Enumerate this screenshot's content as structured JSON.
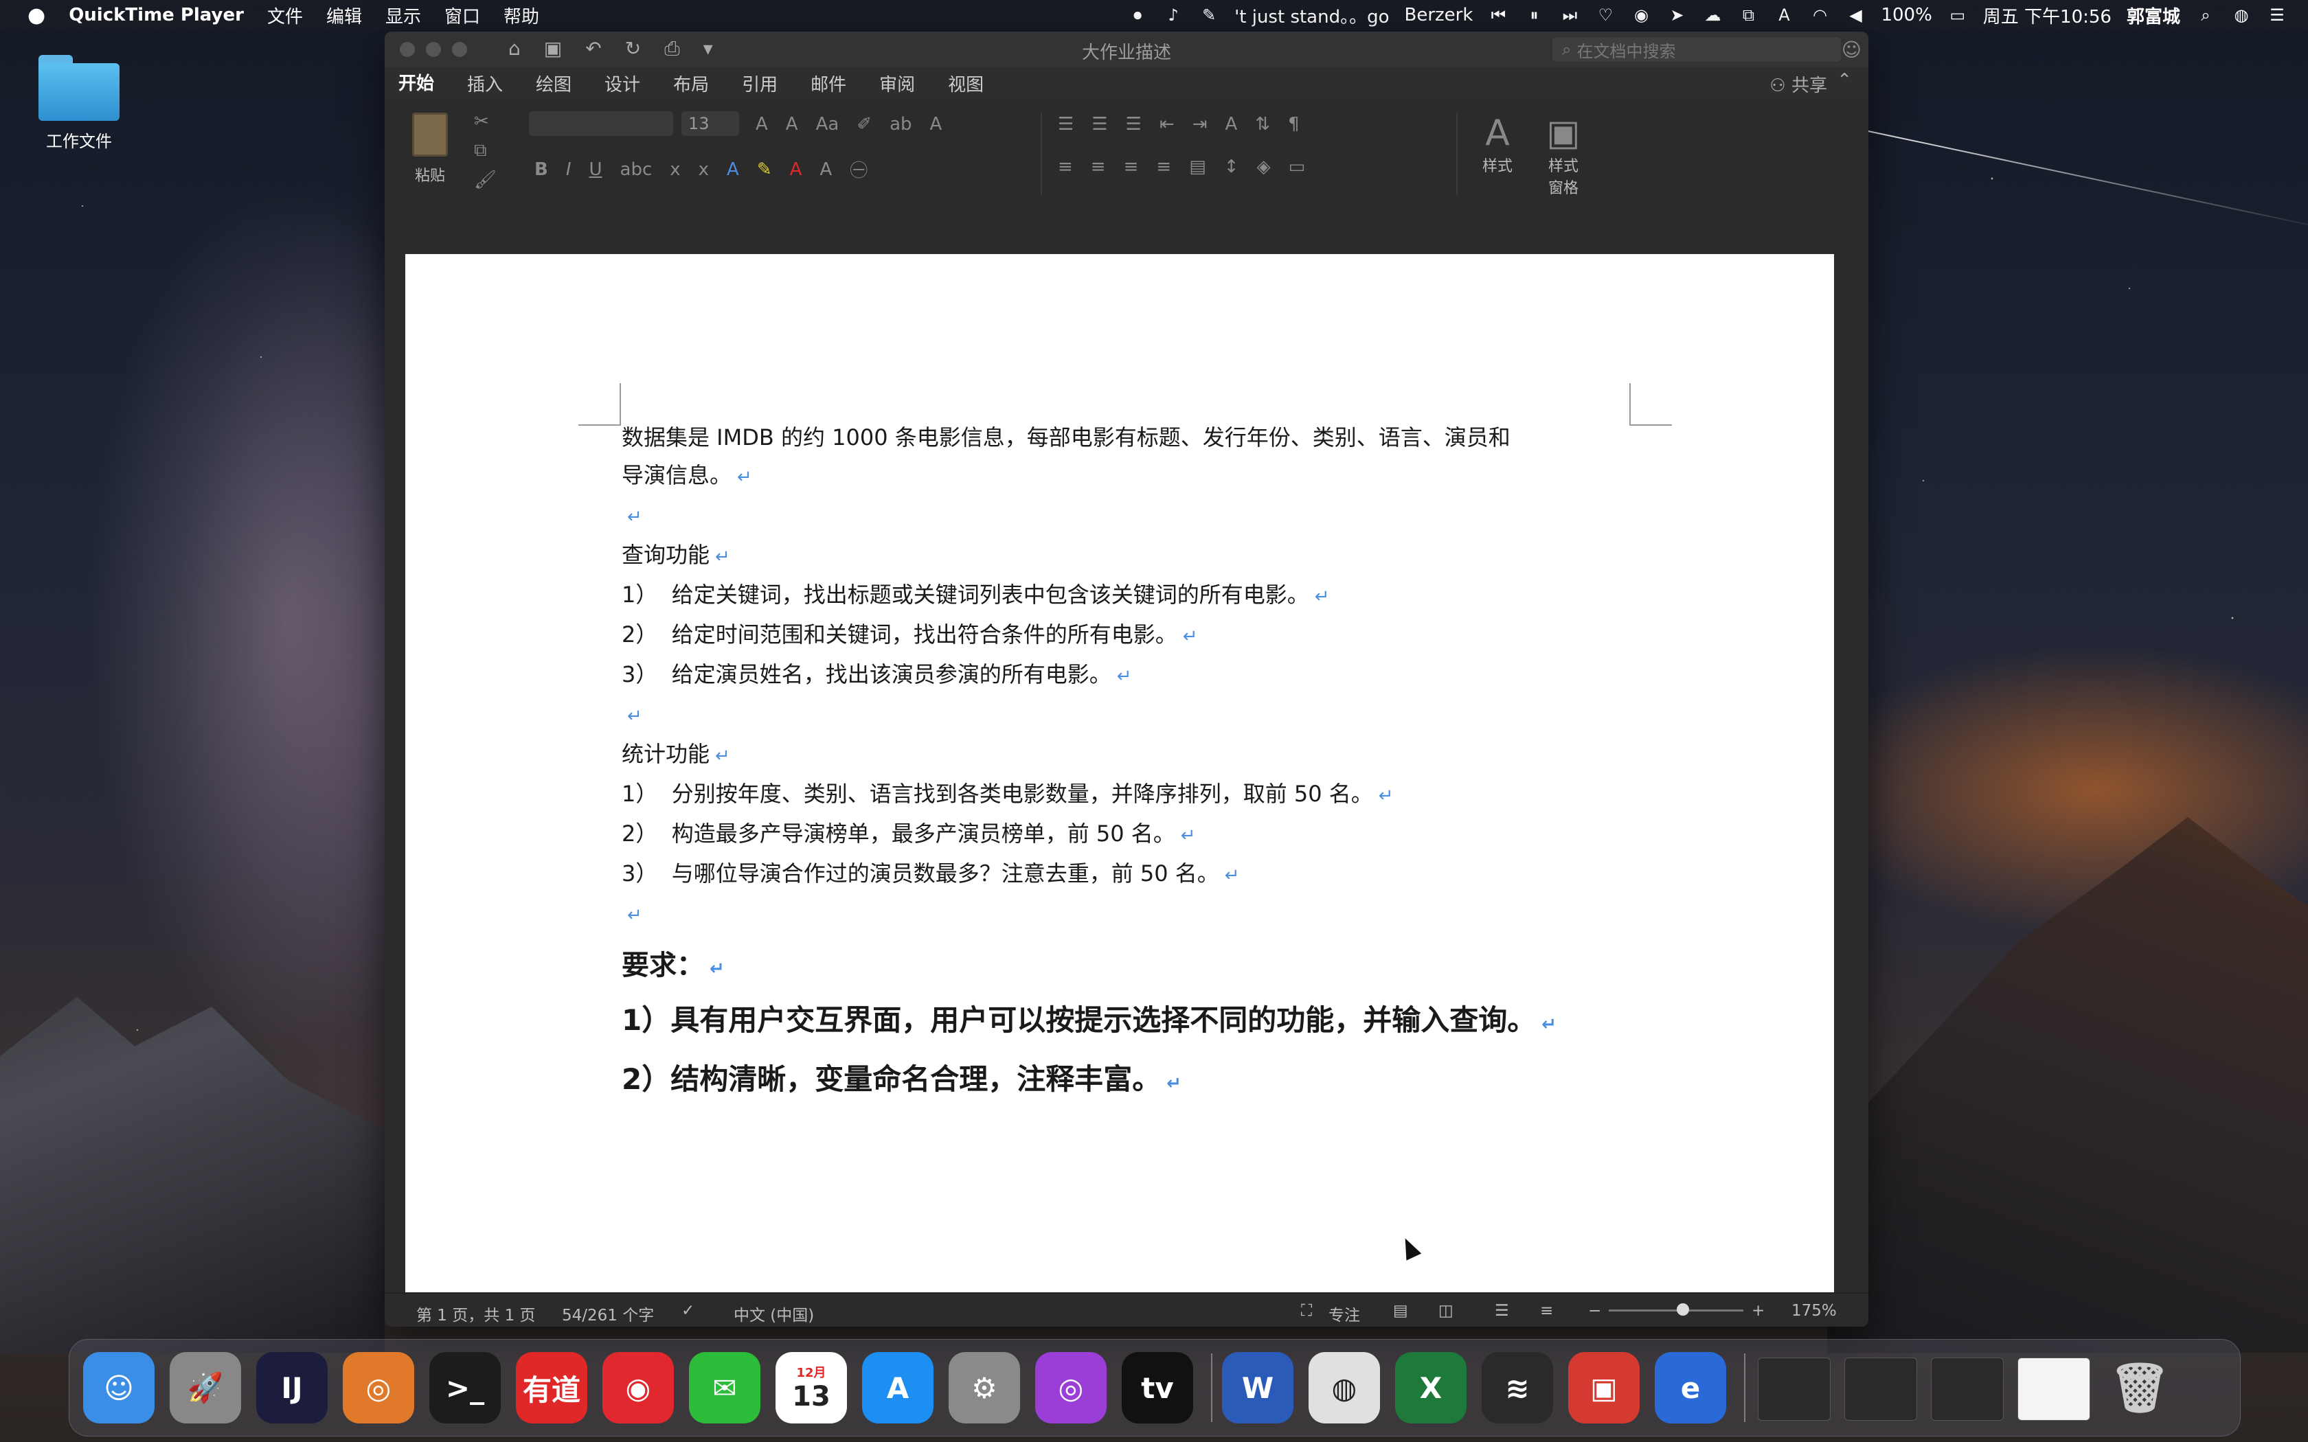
{
  "menubar": {
    "apple": "",
    "app": "QuickTime Player",
    "items": [
      "文件",
      "编辑",
      "显示",
      "窗口",
      "帮助"
    ],
    "now_playing": "'t just stand。。go",
    "artist": "Berzerk",
    "battery": "100%",
    "clock": "周五 下午10:56",
    "user": "郭富城"
  },
  "desktop": {
    "folder_label": "工作文件"
  },
  "word": {
    "doc_title": "大作业描述",
    "search_placeholder": "在文档中搜索",
    "tabs": [
      "开始",
      "插入",
      "绘图",
      "设计",
      "布局",
      "引用",
      "邮件",
      "审阅",
      "视图"
    ],
    "share": "共享",
    "ribbon": {
      "paste": "粘贴",
      "font_size": "13",
      "styles": "样式",
      "styles_pane_1": "样式",
      "styles_pane_2": "窗格"
    },
    "document": {
      "para1_line1": "数据集是 IMDB 的约 1000 条电影信息，每部电影有标题、发行年份、类别、语言、演员和",
      "para1_line2": "导演信息。",
      "query_heading": "查询功能",
      "q1": "1）  给定关键词，找出标题或关键词列表中包含该关键词的所有电影。",
      "q2": "2）  给定时间范围和关键词，找出符合条件的所有电影。",
      "q3": "3）  给定演员姓名，找出该演员参演的所有电影。",
      "stats_heading": "统计功能",
      "s1": "1）  分别按年度、类别、语言找到各类电影数量，并降序排列，取前 50 名。",
      "s2": "2）  构造最多产导演榜单，最多产演员榜单，前 50 名。",
      "s3": "3）  与哪位导演合作过的演员数最多？注意去重，前 50 名。",
      "req_heading": "要求：",
      "r1": "1）具有用户交互界面，用户可以按提示选择不同的功能，并输入查询。",
      "r2": "2）结构清晰，变量命名合理，注释丰富。",
      "para_mark": "↵"
    },
    "status": {
      "page": "第 1 页，共 1 页",
      "words": "54/261 个字",
      "language": "中文 (中国)",
      "focus": "专注",
      "zoom": "175%",
      "zoom_level": 0.55
    }
  },
  "dock": {
    "items": [
      {
        "name": "finder",
        "glyph": "☺",
        "color": "#3a8ee6"
      },
      {
        "name": "launchpad",
        "glyph": "🚀",
        "color": "#888"
      },
      {
        "name": "intellij",
        "glyph": "IJ",
        "color": "#1c1c3c"
      },
      {
        "name": "pycharm-like",
        "glyph": "◎",
        "color": "#e07a2a"
      },
      {
        "name": "terminal",
        "glyph": ">_",
        "color": "#1c1c1c"
      },
      {
        "name": "youdao",
        "glyph": "有道",
        "color": "#e02828"
      },
      {
        "name": "netease-music",
        "glyph": "◉",
        "color": "#e0282e"
      },
      {
        "name": "wechat",
        "glyph": "✉",
        "color": "#2dbb3a"
      },
      {
        "name": "calendar",
        "glyph": "13",
        "color": "#ffffff"
      },
      {
        "name": "app-store",
        "glyph": "A",
        "color": "#1d8ef2"
      },
      {
        "name": "system-preferences",
        "glyph": "⚙",
        "color": "#8a8a8a"
      },
      {
        "name": "podcasts",
        "glyph": "◎",
        "color": "#9b3ed8"
      },
      {
        "name": "apple-tv",
        "glyph": "tv",
        "color": "#111"
      },
      {
        "name": "word",
        "glyph": "W",
        "color": "#2a5bb8"
      },
      {
        "name": "chrome",
        "glyph": "◍",
        "color": "#e0e0e0"
      },
      {
        "name": "excel",
        "glyph": "X",
        "color": "#1d7a3a"
      },
      {
        "name": "sublime",
        "glyph": "≋",
        "color": "#2a2a2a"
      },
      {
        "name": "remote-desktop",
        "glyph": "▣",
        "color": "#d43a30"
      },
      {
        "name": "edge",
        "glyph": "e",
        "color": "#2a6ad8"
      }
    ],
    "calendar_month": "12月"
  },
  "colors": {
    "accent": "#2a5bb8",
    "para_mark": "#4a8ee0"
  }
}
